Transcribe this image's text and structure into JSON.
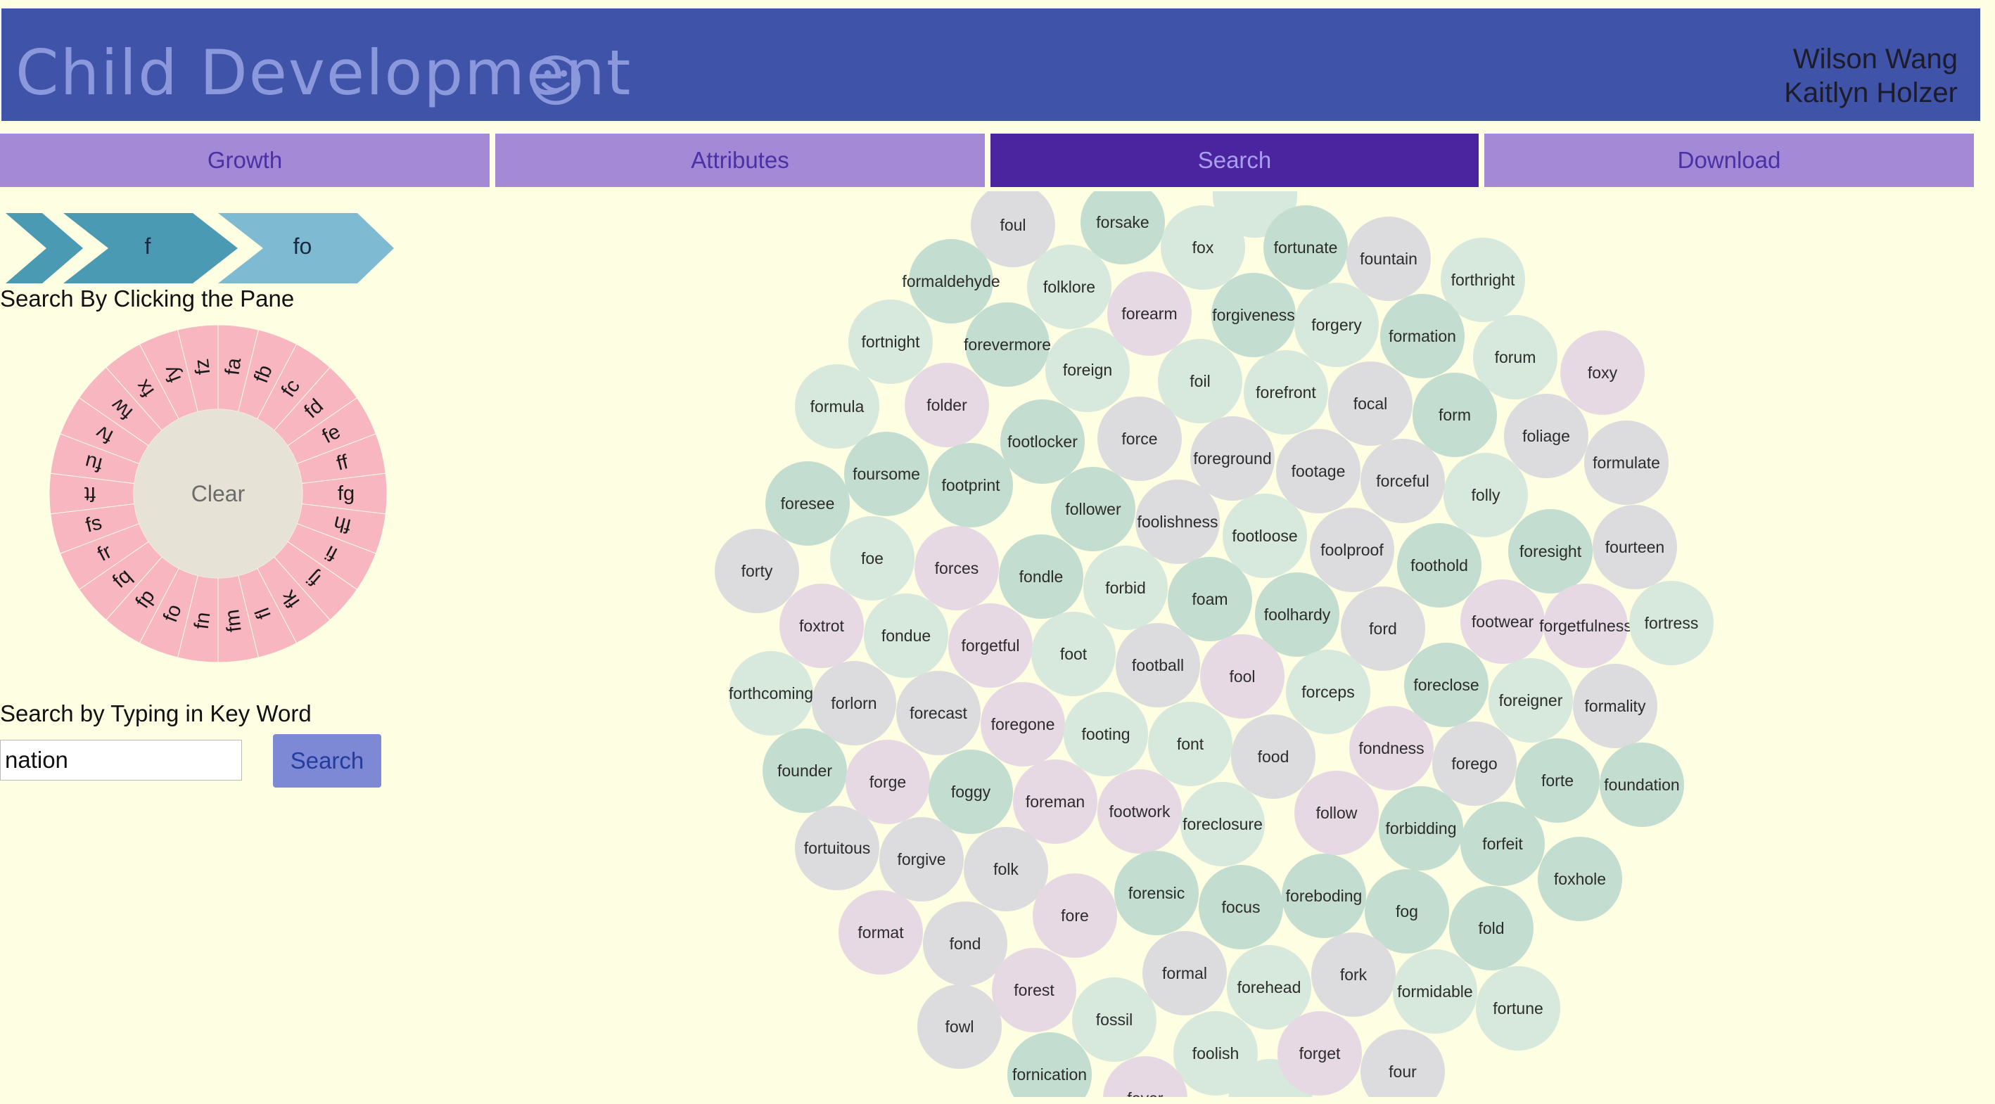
{
  "header": {
    "title": "Child Development",
    "authors": [
      "Wilson Wang",
      "Kaitlyn Holzer"
    ]
  },
  "tabs": [
    {
      "label": "Growth",
      "active": false
    },
    {
      "label": "Attributes",
      "active": false
    },
    {
      "label": "Search",
      "active": true
    },
    {
      "label": "Download",
      "active": false
    }
  ],
  "breadcrumb": [
    "f",
    "fo"
  ],
  "pane": {
    "label": "Search By Clicking the Pane",
    "center_label": "Clear",
    "segments": [
      "fa",
      "fb",
      "fc",
      "fd",
      "fe",
      "ff",
      "fg",
      "fh",
      "fi",
      "fj",
      "fk",
      "fl",
      "fm",
      "fn",
      "fo",
      "fp",
      "fq",
      "fr",
      "fs",
      "ft",
      "fu",
      "fv",
      "fw",
      "fx",
      "fy",
      "fz"
    ]
  },
  "search": {
    "label": "Search by Typing in Key Word",
    "value": "nation",
    "button_label": "Search"
  },
  "colors": {
    "header_bg": "#3f53a9",
    "tab_bg": "#a389d6",
    "tab_active_bg": "#4b24a0",
    "pane_ring": "#f8b6c1",
    "pane_center": "#e6e3d6",
    "bubble_gray": "#dcdcde",
    "bubble_mint": "#d7e8dc",
    "bubble_green": "#c3ddd0",
    "bubble_pink": "#e6d9e3"
  },
  "words": [
    "foul",
    "forsake",
    "fox",
    "fortunate",
    "fountain",
    "forthright",
    "formaldehyde",
    "folklore",
    "forearm",
    "forgiveness",
    "forgery",
    "formation",
    "fortnight",
    "forevermore",
    "foreign",
    "foil",
    "forum",
    "foxy",
    "formula",
    "folder",
    "forefront",
    "focal",
    "form",
    "foliage",
    "footlocker",
    "force",
    "foreground",
    "footage",
    "forceful",
    "formulate",
    "foursome",
    "footprint",
    "folly",
    "foresee",
    "follower",
    "foolishness",
    "footloose",
    "foolproof",
    "foothold",
    "foresight",
    "fourteen",
    "forty",
    "foe",
    "forces",
    "fondle",
    "forbid",
    "foam",
    "foolhardy",
    "ford",
    "footwear",
    "forgetfulness",
    "fortress",
    "foxtrot",
    "fondue",
    "forgetful",
    "foot",
    "football",
    "fool",
    "forceps",
    "foreclose",
    "foreigner",
    "formality",
    "forthcoming",
    "forlorn",
    "forecast",
    "foregone",
    "footing",
    "font",
    "food",
    "fondness",
    "forego",
    "forte",
    "foundation",
    "founder",
    "forge",
    "foggy",
    "foreman",
    "footwork",
    "foreclosure",
    "follow",
    "forbidding",
    "forfeit",
    "fortuitous",
    "forgive",
    "folk",
    "foxhole",
    "forensic",
    "focus",
    "foreboding",
    "fog",
    "fold",
    "format",
    "fond",
    "fore",
    "formal",
    "forehead",
    "fork",
    "formidable",
    "fortune",
    "forest",
    "fowl",
    "fossil",
    "foolish",
    "forget",
    "four",
    "fornication",
    "fever"
  ]
}
